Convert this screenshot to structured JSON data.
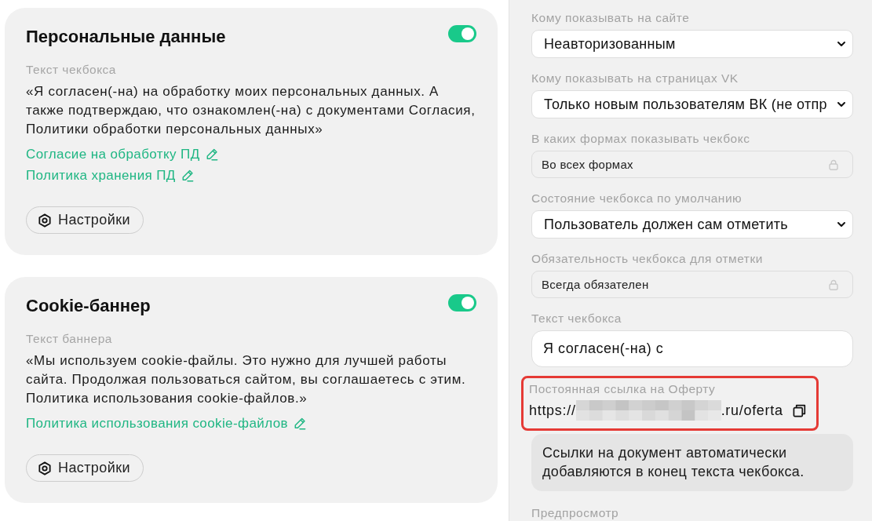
{
  "cards": [
    {
      "title": "Персональные данные",
      "enabled": true,
      "text_label": "Текст чекбокса",
      "text": "«Я согласен(-на) на обработку моих персональных данных. А также подтверждаю, что ознакомлен(-на) с документами Согласия, Политики обработки персональных данных»",
      "links": [
        "Согласие на обработку ПД",
        "Политика хранения ПД"
      ],
      "button": "Настройки"
    },
    {
      "title": "Cookie-баннер",
      "enabled": true,
      "text_label": "Текст баннера",
      "text": "«Мы используем cookie-файлы. Это нужно для лучшей работы сайта. Продолжая пользоваться сайтом, вы соглашаетесь с этим. Политика использования cookie-файлов.»",
      "links": [
        "Политика использования cookie-файлов"
      ],
      "button": "Настройки"
    }
  ],
  "settings": {
    "fields": [
      {
        "kind": "select",
        "label": "Кому показывать на сайте",
        "value": "Неавторизованным"
      },
      {
        "kind": "select",
        "label": "Кому показывать на страницах VK",
        "value": "Только новым пользователям ВК (не отпр"
      },
      {
        "kind": "locked",
        "label": "В каких формах показывать чекбокс",
        "value": "Во всех формах"
      },
      {
        "kind": "select",
        "label": "Состояние чекбокса по умолчанию",
        "value": "Пользователь должен сам отметить"
      },
      {
        "kind": "locked",
        "label": "Обязательность чекбокса для отметки",
        "value": "Всегда обязателен"
      },
      {
        "kind": "text",
        "label": "Текст чекбокса",
        "value": "Я согласен(-на) с"
      },
      {
        "kind": "link",
        "label": "Постоянная ссылка на Оферту",
        "url_start": "https://",
        "url_end": ".ru/oferta",
        "highlighted": true
      },
      {
        "kind": "note",
        "text": "Ссылки на документ автоматически добавляются в конец текста чекбокса."
      },
      {
        "kind": "heading",
        "label": "Предпросмотр"
      }
    ]
  }
}
